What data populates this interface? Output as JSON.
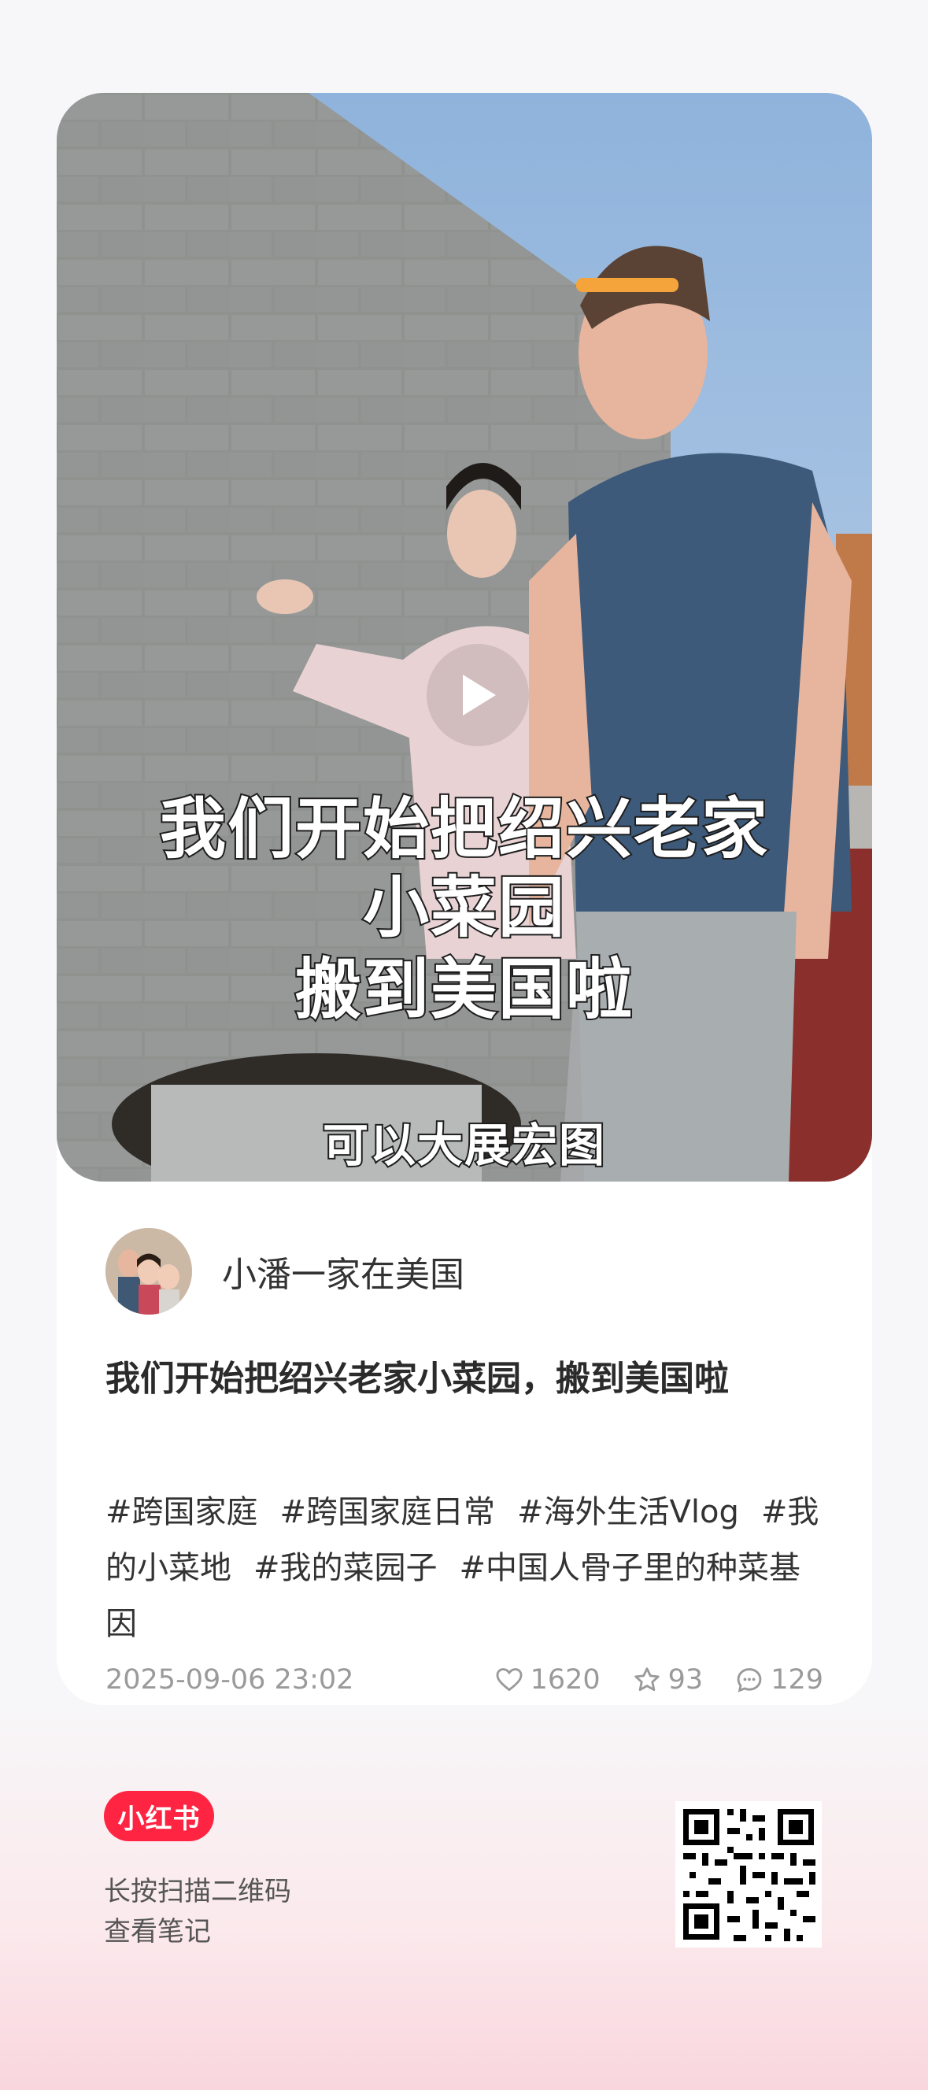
{
  "cover": {
    "caption_line1": "我们开始把绍兴老家",
    "caption_line2": "小菜园",
    "caption_line3": "搬到美国啦",
    "caption_line4": "可以大展宏图",
    "play_icon": "play-icon"
  },
  "author": {
    "name": "小潘一家在美国"
  },
  "note": {
    "title": "我们开始把绍兴老家小菜园，搬到美国啦",
    "tags": [
      "#跨国家庭",
      "#跨国家庭日常",
      "#海外生活Vlog",
      "#我的小菜地",
      "#我的菜园子",
      "#中国人骨子里的种菜基因"
    ],
    "date": "2025-09-06 23:02",
    "likes": "1620",
    "collects": "93",
    "comments": "129"
  },
  "footer": {
    "brand": "小红书",
    "hint_line1": "长按扫描二维码",
    "hint_line2": "查看笔记"
  },
  "colors": {
    "brand": "#ff2442",
    "text_primary": "#333333",
    "text_secondary": "#9a9a9a"
  }
}
